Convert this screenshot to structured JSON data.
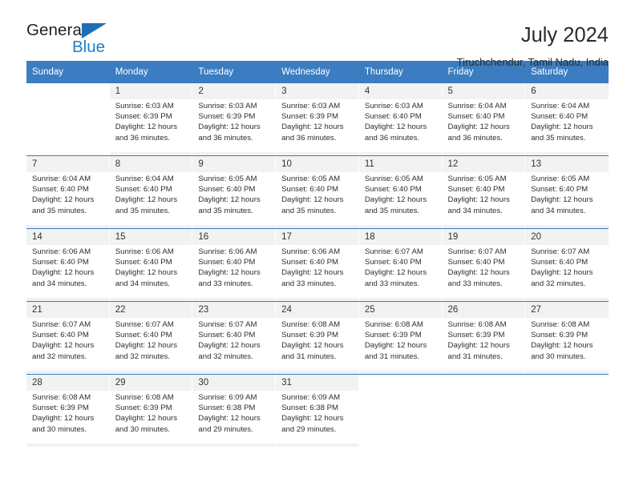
{
  "brand": {
    "name_top": "General",
    "name_bottom": "Blue",
    "triangle_color": "#1c6fb5",
    "blue_color": "#1f7fc4"
  },
  "header": {
    "title": "July 2024",
    "location": "Tiruchchendur, Tamil Nadu, India"
  },
  "theme": {
    "header_bg": "#3b7dc0",
    "header_text": "#ffffff",
    "row_shade": "#f2f2f2",
    "cell_bg": "#ffffff"
  },
  "weekdays": [
    "Sunday",
    "Monday",
    "Tuesday",
    "Wednesday",
    "Thursday",
    "Friday",
    "Saturday"
  ],
  "weeks": [
    [
      {
        "day": "",
        "lines": []
      },
      {
        "day": "1",
        "lines": [
          "Sunrise: 6:03 AM",
          "Sunset: 6:39 PM",
          "Daylight: 12 hours",
          "and 36 minutes."
        ]
      },
      {
        "day": "2",
        "lines": [
          "Sunrise: 6:03 AM",
          "Sunset: 6:39 PM",
          "Daylight: 12 hours",
          "and 36 minutes."
        ]
      },
      {
        "day": "3",
        "lines": [
          "Sunrise: 6:03 AM",
          "Sunset: 6:39 PM",
          "Daylight: 12 hours",
          "and 36 minutes."
        ]
      },
      {
        "day": "4",
        "lines": [
          "Sunrise: 6:03 AM",
          "Sunset: 6:40 PM",
          "Daylight: 12 hours",
          "and 36 minutes."
        ]
      },
      {
        "day": "5",
        "lines": [
          "Sunrise: 6:04 AM",
          "Sunset: 6:40 PM",
          "Daylight: 12 hours",
          "and 36 minutes."
        ]
      },
      {
        "day": "6",
        "lines": [
          "Sunrise: 6:04 AM",
          "Sunset: 6:40 PM",
          "Daylight: 12 hours",
          "and 35 minutes."
        ]
      }
    ],
    [
      {
        "day": "7",
        "lines": [
          "Sunrise: 6:04 AM",
          "Sunset: 6:40 PM",
          "Daylight: 12 hours",
          "and 35 minutes."
        ]
      },
      {
        "day": "8",
        "lines": [
          "Sunrise: 6:04 AM",
          "Sunset: 6:40 PM",
          "Daylight: 12 hours",
          "and 35 minutes."
        ]
      },
      {
        "day": "9",
        "lines": [
          "Sunrise: 6:05 AM",
          "Sunset: 6:40 PM",
          "Daylight: 12 hours",
          "and 35 minutes."
        ]
      },
      {
        "day": "10",
        "lines": [
          "Sunrise: 6:05 AM",
          "Sunset: 6:40 PM",
          "Daylight: 12 hours",
          "and 35 minutes."
        ]
      },
      {
        "day": "11",
        "lines": [
          "Sunrise: 6:05 AM",
          "Sunset: 6:40 PM",
          "Daylight: 12 hours",
          "and 35 minutes."
        ]
      },
      {
        "day": "12",
        "lines": [
          "Sunrise: 6:05 AM",
          "Sunset: 6:40 PM",
          "Daylight: 12 hours",
          "and 34 minutes."
        ]
      },
      {
        "day": "13",
        "lines": [
          "Sunrise: 6:05 AM",
          "Sunset: 6:40 PM",
          "Daylight: 12 hours",
          "and 34 minutes."
        ]
      }
    ],
    [
      {
        "day": "14",
        "lines": [
          "Sunrise: 6:06 AM",
          "Sunset: 6:40 PM",
          "Daylight: 12 hours",
          "and 34 minutes."
        ]
      },
      {
        "day": "15",
        "lines": [
          "Sunrise: 6:06 AM",
          "Sunset: 6:40 PM",
          "Daylight: 12 hours",
          "and 34 minutes."
        ]
      },
      {
        "day": "16",
        "lines": [
          "Sunrise: 6:06 AM",
          "Sunset: 6:40 PM",
          "Daylight: 12 hours",
          "and 33 minutes."
        ]
      },
      {
        "day": "17",
        "lines": [
          "Sunrise: 6:06 AM",
          "Sunset: 6:40 PM",
          "Daylight: 12 hours",
          "and 33 minutes."
        ]
      },
      {
        "day": "18",
        "lines": [
          "Sunrise: 6:07 AM",
          "Sunset: 6:40 PM",
          "Daylight: 12 hours",
          "and 33 minutes."
        ]
      },
      {
        "day": "19",
        "lines": [
          "Sunrise: 6:07 AM",
          "Sunset: 6:40 PM",
          "Daylight: 12 hours",
          "and 33 minutes."
        ]
      },
      {
        "day": "20",
        "lines": [
          "Sunrise: 6:07 AM",
          "Sunset: 6:40 PM",
          "Daylight: 12 hours",
          "and 32 minutes."
        ]
      }
    ],
    [
      {
        "day": "21",
        "lines": [
          "Sunrise: 6:07 AM",
          "Sunset: 6:40 PM",
          "Daylight: 12 hours",
          "and 32 minutes."
        ]
      },
      {
        "day": "22",
        "lines": [
          "Sunrise: 6:07 AM",
          "Sunset: 6:40 PM",
          "Daylight: 12 hours",
          "and 32 minutes."
        ]
      },
      {
        "day": "23",
        "lines": [
          "Sunrise: 6:07 AM",
          "Sunset: 6:40 PM",
          "Daylight: 12 hours",
          "and 32 minutes."
        ]
      },
      {
        "day": "24",
        "lines": [
          "Sunrise: 6:08 AM",
          "Sunset: 6:39 PM",
          "Daylight: 12 hours",
          "and 31 minutes."
        ]
      },
      {
        "day": "25",
        "lines": [
          "Sunrise: 6:08 AM",
          "Sunset: 6:39 PM",
          "Daylight: 12 hours",
          "and 31 minutes."
        ]
      },
      {
        "day": "26",
        "lines": [
          "Sunrise: 6:08 AM",
          "Sunset: 6:39 PM",
          "Daylight: 12 hours",
          "and 31 minutes."
        ]
      },
      {
        "day": "27",
        "lines": [
          "Sunrise: 6:08 AM",
          "Sunset: 6:39 PM",
          "Daylight: 12 hours",
          "and 30 minutes."
        ]
      }
    ],
    [
      {
        "day": "28",
        "lines": [
          "Sunrise: 6:08 AM",
          "Sunset: 6:39 PM",
          "Daylight: 12 hours",
          "and 30 minutes."
        ]
      },
      {
        "day": "29",
        "lines": [
          "Sunrise: 6:08 AM",
          "Sunset: 6:39 PM",
          "Daylight: 12 hours",
          "and 30 minutes."
        ]
      },
      {
        "day": "30",
        "lines": [
          "Sunrise: 6:09 AM",
          "Sunset: 6:38 PM",
          "Daylight: 12 hours",
          "and 29 minutes."
        ]
      },
      {
        "day": "31",
        "lines": [
          "Sunrise: 6:09 AM",
          "Sunset: 6:38 PM",
          "Daylight: 12 hours",
          "and 29 minutes."
        ]
      },
      {
        "day": "",
        "lines": []
      },
      {
        "day": "",
        "lines": []
      },
      {
        "day": "",
        "lines": []
      }
    ]
  ]
}
